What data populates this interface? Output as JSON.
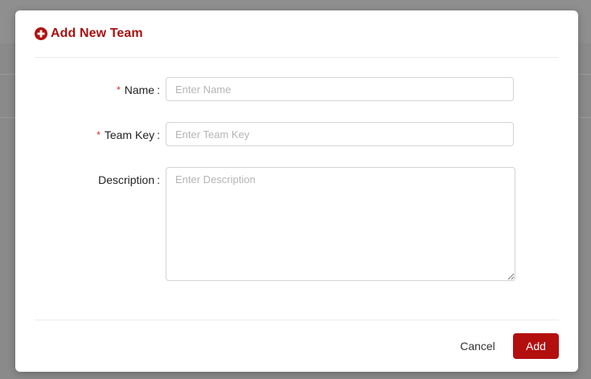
{
  "dialog": {
    "title": "Add New Team",
    "title_icon": "plus-circle-icon",
    "accent_color": "#b30f0f"
  },
  "form": {
    "name": {
      "label": "Name",
      "required": true,
      "value": "",
      "placeholder": "Enter Name"
    },
    "team_key": {
      "label": "Team Key",
      "required": true,
      "value": "",
      "placeholder": "Enter Team Key"
    },
    "description": {
      "label": "Description",
      "required": false,
      "value": "",
      "placeholder": "Enter Description"
    },
    "required_marker": "*",
    "label_suffix": ":"
  },
  "footer": {
    "cancel_label": "Cancel",
    "add_label": "Add"
  }
}
